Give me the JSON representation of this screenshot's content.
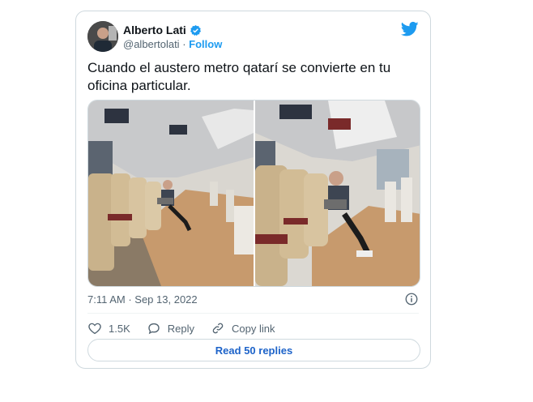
{
  "author": {
    "name": "Alberto Lati",
    "handle": "@albertolati",
    "follow_label": "Follow"
  },
  "tweet": {
    "text": "Cuando el austero metro qatarí se convierte en tu oficina particular.",
    "timestamp": "7:11 AM · Sep 13, 2022"
  },
  "actions": {
    "likes": "1.5K",
    "reply_label": "Reply",
    "copy_label": "Copy link"
  },
  "read_replies_label": "Read 50 replies",
  "colors": {
    "brand_blue": "#1d9bf0",
    "text_secondary": "#536471",
    "border": "#cfd9de"
  },
  "icons": {
    "verified": "verified-badge-icon",
    "logo": "twitter-bird-icon",
    "info": "info-icon",
    "like": "heart-icon",
    "reply": "speech-bubble-icon",
    "copy": "link-icon"
  }
}
